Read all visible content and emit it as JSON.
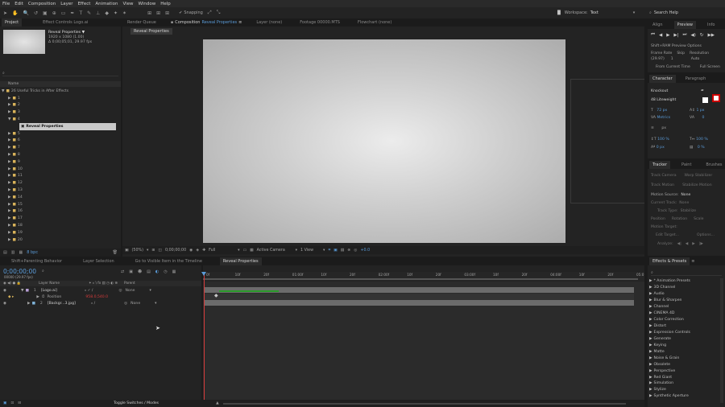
{
  "menu": [
    "File",
    "Edit",
    "Composition",
    "Layer",
    "Effect",
    "Animation",
    "View",
    "Window",
    "Help"
  ],
  "toolbar": {
    "snapping": "Snapping",
    "workspace_label": "Workspace:",
    "workspace_value": "Text",
    "search_placeholder": "Search Help"
  },
  "project": {
    "tabs": [
      "Project",
      "Effect Controls Logo.ai"
    ],
    "item_name": "Reveal Properties ▼",
    "item_size": "1920 x 1080 (1.00)",
    "item_duration": "Δ 0;00;05;01, 29.97 fps",
    "name_header": "Name",
    "root_folder": "26 Useful Tricks in After Effects",
    "folders": [
      "1",
      "2",
      "3",
      "4",
      "5",
      "6",
      "7",
      "8",
      "9",
      "10",
      "11",
      "12",
      "13",
      "14",
      "15",
      "16",
      "17",
      "18",
      "19",
      "20"
    ],
    "selected_item": "Reveal Properties",
    "bpc": "8 bpc"
  },
  "viewer": {
    "tabs": [
      "Render Queue",
      "Composition",
      "Reveal Properties",
      "Layer (none)",
      "Footage 00000.MTS",
      "Flowchart (none)"
    ],
    "subtab": "Reveal Properties",
    "zoom": "(50%)",
    "timecode": "0;00;00;00",
    "resolution": "Full",
    "camera": "Active Camera",
    "views": "1 View",
    "exposure": "+0.0"
  },
  "preview": {
    "tabs": [
      "Align",
      "Preview",
      "Info"
    ],
    "ram_options": "Shift+RAM Preview Options",
    "frame_rate_label": "Frame Rate",
    "skip_label": "Skip",
    "resolution_label": "Resolution",
    "frame_rate": "(29.97)",
    "skip": "1",
    "resolution": "Auto",
    "from_current": "From Current Time",
    "full_screen": "Full Screen"
  },
  "character": {
    "tabs": [
      "Character",
      "Paragraph"
    ],
    "font": "Knockout",
    "style": "48 Liteweight",
    "size": "72 px",
    "leading": "1 px",
    "kerning": "Metrics",
    "tracking": "0",
    "stroke": "px",
    "vscale": "100 %",
    "hscale": "100 %",
    "baseline": "0 px",
    "tsume": "0 %"
  },
  "tracker": {
    "tabs": [
      "Tracker",
      "Paint",
      "Brushes"
    ],
    "track_camera": "Track Camera",
    "warp_stabilizer": "Warp Stabilizer",
    "track_motion": "Track Motion",
    "stabilize_motion": "Stabilize Motion",
    "motion_source_label": "Motion Source:",
    "motion_source": "None",
    "current_track_label": "Current Track:",
    "current_track": "None",
    "track_type_label": "Track Type:",
    "track_type": "Stabilize",
    "position": "Position",
    "rotation": "Rotation",
    "scale": "Scale",
    "motion_target": "Motion Target:",
    "edit_target": "Edit Target...",
    "options": "Options...",
    "analyze": "Analyze:"
  },
  "effects": {
    "title": "Effects & Presets",
    "items": [
      "* Animation Presets",
      "3D Channel",
      "Audio",
      "Blur & Sharpen",
      "Channel",
      "CINEMA 4D",
      "Color Correction",
      "Distort",
      "Expression Controls",
      "Generate",
      "Keying",
      "Matte",
      "Noise & Grain",
      "Obsolete",
      "Perspective",
      "Red Giant",
      "Simulation",
      "Stylize",
      "Synthetic Aperture"
    ]
  },
  "timeline": {
    "tabs": [
      "Shift+Parenting Behavior",
      "Layer Selection",
      "Go to Visible Item in the Timeline",
      "Reveal Properties"
    ],
    "timecode": "0;00;00;00",
    "fps_info": "00000 (29.97 fps)",
    "layer_name_header": "Layer Name",
    "parent_header": "Parent",
    "layers": [
      {
        "num": "1",
        "name": "[Logo.ai]",
        "parent": "None"
      },
      {
        "num": "2",
        "name": "[Backgr...3.jpg]",
        "parent": "None"
      }
    ],
    "position_label": "Position",
    "position_value": "958.0,540.0",
    "ruler": [
      "0f",
      "10f",
      "20f",
      "01:00f",
      "10f",
      "20f",
      "02:00f",
      "10f",
      "20f",
      "03:00f",
      "10f",
      "20f",
      "04:00f",
      "10f",
      "20f",
      "05:0"
    ],
    "toggle": "Toggle Switches / Modes"
  }
}
